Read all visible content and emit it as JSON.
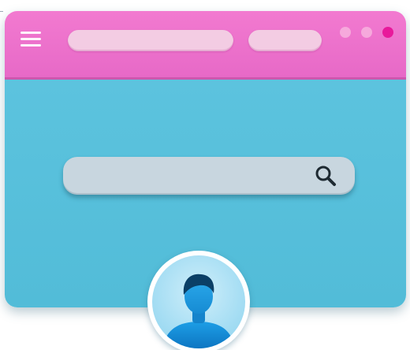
{
  "window": {
    "titlebar_color": "#ec72cb",
    "content_color": "#57bfda",
    "menu_icon": "hamburger-menu-icon",
    "address_pill": "",
    "secondary_pill": "",
    "window_controls": [
      {
        "name": "window-dot-1",
        "color": "#f6a9dc"
      },
      {
        "name": "window-dot-2",
        "color": "#f6a9dc"
      },
      {
        "name": "window-dot-3",
        "color": "#e8199b"
      }
    ]
  },
  "search": {
    "value": "",
    "placeholder": "",
    "icon": "search-icon",
    "bar_color": "#c8d6df"
  },
  "avatar": {
    "icon": "user-avatar-icon",
    "figure_color": "#1a8fd6"
  }
}
